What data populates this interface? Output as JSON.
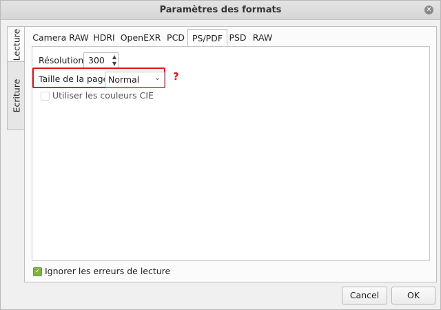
{
  "window": {
    "title": "Paramètres des formats"
  },
  "side_tabs": [
    {
      "label": "Lecture",
      "active": true
    },
    {
      "label": "Ecriture",
      "active": false
    }
  ],
  "format_tabs": [
    "Camera RAW",
    "HDRI",
    "OpenEXR",
    "PCD",
    "PS/PDF",
    "PSD",
    "RAW"
  ],
  "active_format_tab": "PS/PDF",
  "ps_pdf": {
    "resolution_label": "Résolution",
    "resolution_value": "300",
    "page_size_label": "Taille de la page",
    "page_size_value": "Normal",
    "annotation_mark": "?",
    "cie_label": "Utiliser les couleurs CIE",
    "cie_checked": false
  },
  "ignore_errors": {
    "label": "Ignorer les erreurs de lecture",
    "checked": true
  },
  "buttons": {
    "cancel": "Cancel",
    "ok": "OK"
  },
  "colors": {
    "highlight": "#e0161e",
    "check_accent": "#7cb342"
  }
}
